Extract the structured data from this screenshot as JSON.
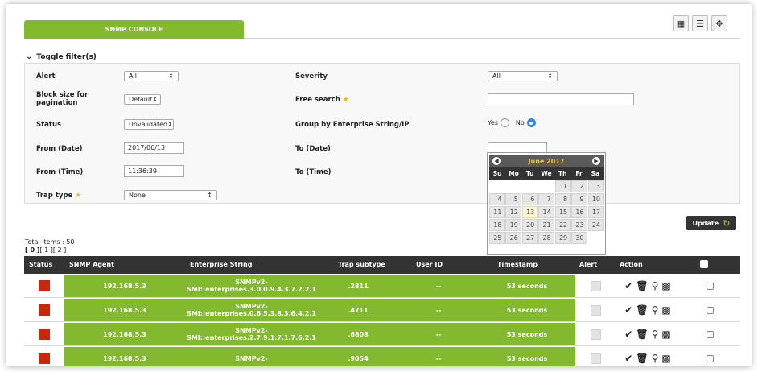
{
  "console_tab": "SNMP CONSOLE",
  "view_icons": [
    "chart-icon",
    "list-icon",
    "fullscreen-icon"
  ],
  "toggle_filters": "Toggle filter(s)",
  "filters": {
    "alert_label": "Alert",
    "alert_value": "All",
    "severity_label": "Severity",
    "severity_value": "All",
    "block_size_label": "Block size for pagination",
    "block_size_value": "Default",
    "free_search_label": "Free search",
    "free_search_value": "",
    "status_label": "Status",
    "status_value": "Unvalidated",
    "group_by_label": "Group by Enterprise String/IP",
    "group_yes": "Yes",
    "group_no": "No",
    "group_selected": "No",
    "from_date_label": "From (Date)",
    "from_date_value": "2017/06/13",
    "to_date_label": "To (Date)",
    "to_date_value": "",
    "from_time_label": "From (Time)",
    "from_time_value": "11:36:39",
    "to_time_label": "To (Time)",
    "trap_type_label": "Trap type",
    "trap_type_value": "None"
  },
  "calendar": {
    "title": "June 2017",
    "days": [
      "Su",
      "Mo",
      "Tu",
      "We",
      "Th",
      "Fr",
      "Sa"
    ],
    "cells": [
      "",
      "",
      "",
      "",
      "1",
      "2",
      "3",
      "4",
      "5",
      "6",
      "7",
      "8",
      "9",
      "10",
      "11",
      "12",
      "13",
      "14",
      "15",
      "16",
      "17",
      "18",
      "19",
      "20",
      "21",
      "22",
      "23",
      "24",
      "25",
      "26",
      "27",
      "28",
      "29",
      "30",
      ""
    ],
    "today": "13"
  },
  "update_button": "Update",
  "total_items": "Total items : 50",
  "pager": [
    "[ 0 ]",
    "[ 1 ]",
    "[ 2 ]"
  ],
  "table": {
    "headers": [
      "Status",
      "SNMP Agent",
      "Enterprise String",
      "Trap subtype",
      "User ID",
      "Timestamp",
      "Alert",
      "Action"
    ],
    "rows": [
      {
        "agent": "192.168.5.3",
        "enterprise_1": "SNMPv2-",
        "enterprise_2": "SMI::enterprises.3.0.0.9.4.3.7.2.2.1",
        "subtype": ".2811",
        "user": "--",
        "timestamp": "53 seconds"
      },
      {
        "agent": "192.168.5.3",
        "enterprise_1": "SNMPv2-",
        "enterprise_2": "SMI::enterprises.0.6.5.3.8.3.6.4.2.1",
        "subtype": ".4711",
        "user": "--",
        "timestamp": "53 seconds"
      },
      {
        "agent": "192.168.5.3",
        "enterprise_1": "SNMPv2-",
        "enterprise_2": "SMI::enterprises.2.7.9.1.7.1.7.6.2.1",
        "subtype": ".6808",
        "user": "--",
        "timestamp": "53 seconds"
      },
      {
        "agent": "192.168.5.3",
        "enterprise_1": "SNMPv2-",
        "enterprise_2": "",
        "subtype": ".9054",
        "user": "--",
        "timestamp": "53 seconds"
      }
    ]
  },
  "colors": {
    "accent": "#82b92e",
    "status_red": "#c8270e",
    "header_dark": "#333333"
  }
}
